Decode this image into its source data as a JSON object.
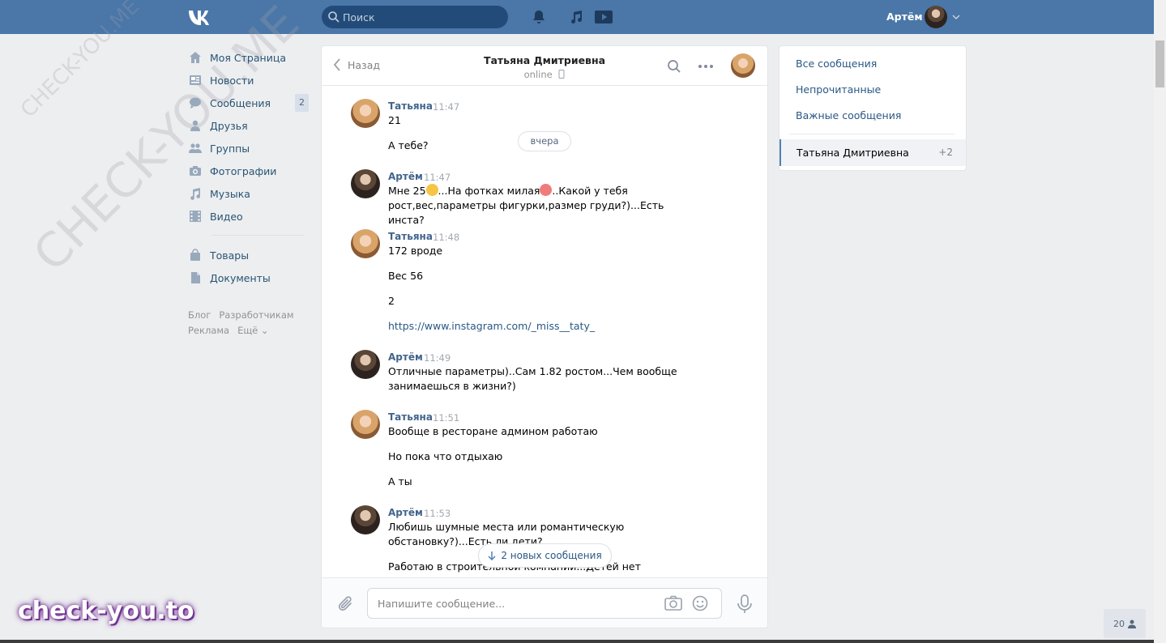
{
  "header": {
    "search_placeholder": "Поиск",
    "user_name": "Артём"
  },
  "watermarks": {
    "diagonal_large": "CHECK-YOU.ME",
    "diagonal_small": "CHECK-YOU.ME",
    "brand": "check-you.to"
  },
  "nav": {
    "items": [
      {
        "label": "Моя Страница",
        "icon": "home-icon"
      },
      {
        "label": "Новости",
        "icon": "news-icon"
      },
      {
        "label": "Сообщения",
        "icon": "messages-icon",
        "badge": "2"
      },
      {
        "label": "Друзья",
        "icon": "friends-icon"
      },
      {
        "label": "Группы",
        "icon": "groups-icon"
      },
      {
        "label": "Фотографии",
        "icon": "photos-icon"
      },
      {
        "label": "Музыка",
        "icon": "music-icon"
      },
      {
        "label": "Видео",
        "icon": "video-icon"
      },
      {
        "label": "Товары",
        "icon": "goods-icon"
      },
      {
        "label": "Документы",
        "icon": "documents-icon"
      }
    ],
    "footer": [
      "Блог",
      "Разработчикам",
      "Реклама",
      "Ещё ⌄"
    ]
  },
  "chat": {
    "back_label": "Назад",
    "title": "Татьяна Дмитриевна",
    "status": "online",
    "date_divider": "вчера",
    "messages": [
      {
        "author": "Татьяна",
        "time": "11:47",
        "lines": [
          "21",
          "А тебе?"
        ]
      },
      {
        "author": "Артём",
        "time": "11:47",
        "lines": [
          "Мне 25",
          "...На фотках милая",
          "..Какой у тебя",
          "рост,вес,параметры фигурки,размер груди?)...Есть инста?"
        ]
      },
      {
        "author": "Татьяна",
        "time": "11:48",
        "lines": [
          "172 вроде",
          "Вес 56",
          "2",
          "https://www.instagram.com/_miss__taty_"
        ]
      },
      {
        "author": "Артём",
        "time": "11:49",
        "lines": [
          "Отличные параметры)..Сам 1.82 ростом...Чем вообще",
          "занимаешься в жизни?)"
        ]
      },
      {
        "author": "Татьяна",
        "time": "11:51",
        "lines": [
          "Вообще в ресторане админом работаю",
          "Но пока что отдыхаю",
          "А ты"
        ]
      },
      {
        "author": "Артём",
        "time": "11:53",
        "lines": [
          "Любишь шумные места или романтическую",
          "обстановку?)...Есть ли дети?",
          "Работаю в строительной компании...Детей нет"
        ]
      }
    ],
    "new_messages_label": "2 новых сообщения",
    "composer_placeholder": "Напишите сообщение..."
  },
  "right_panel": {
    "all": "Все сообщения",
    "unread": "Непрочитанные",
    "important": "Важные сообщения",
    "active_chat": "Татьяна Дмитриевна",
    "active_count": "+2"
  },
  "online_count": "20",
  "colors": {
    "header": "#4a76a8",
    "link": "#2a5885",
    "author": "#42648b",
    "background": "#edeef0"
  }
}
